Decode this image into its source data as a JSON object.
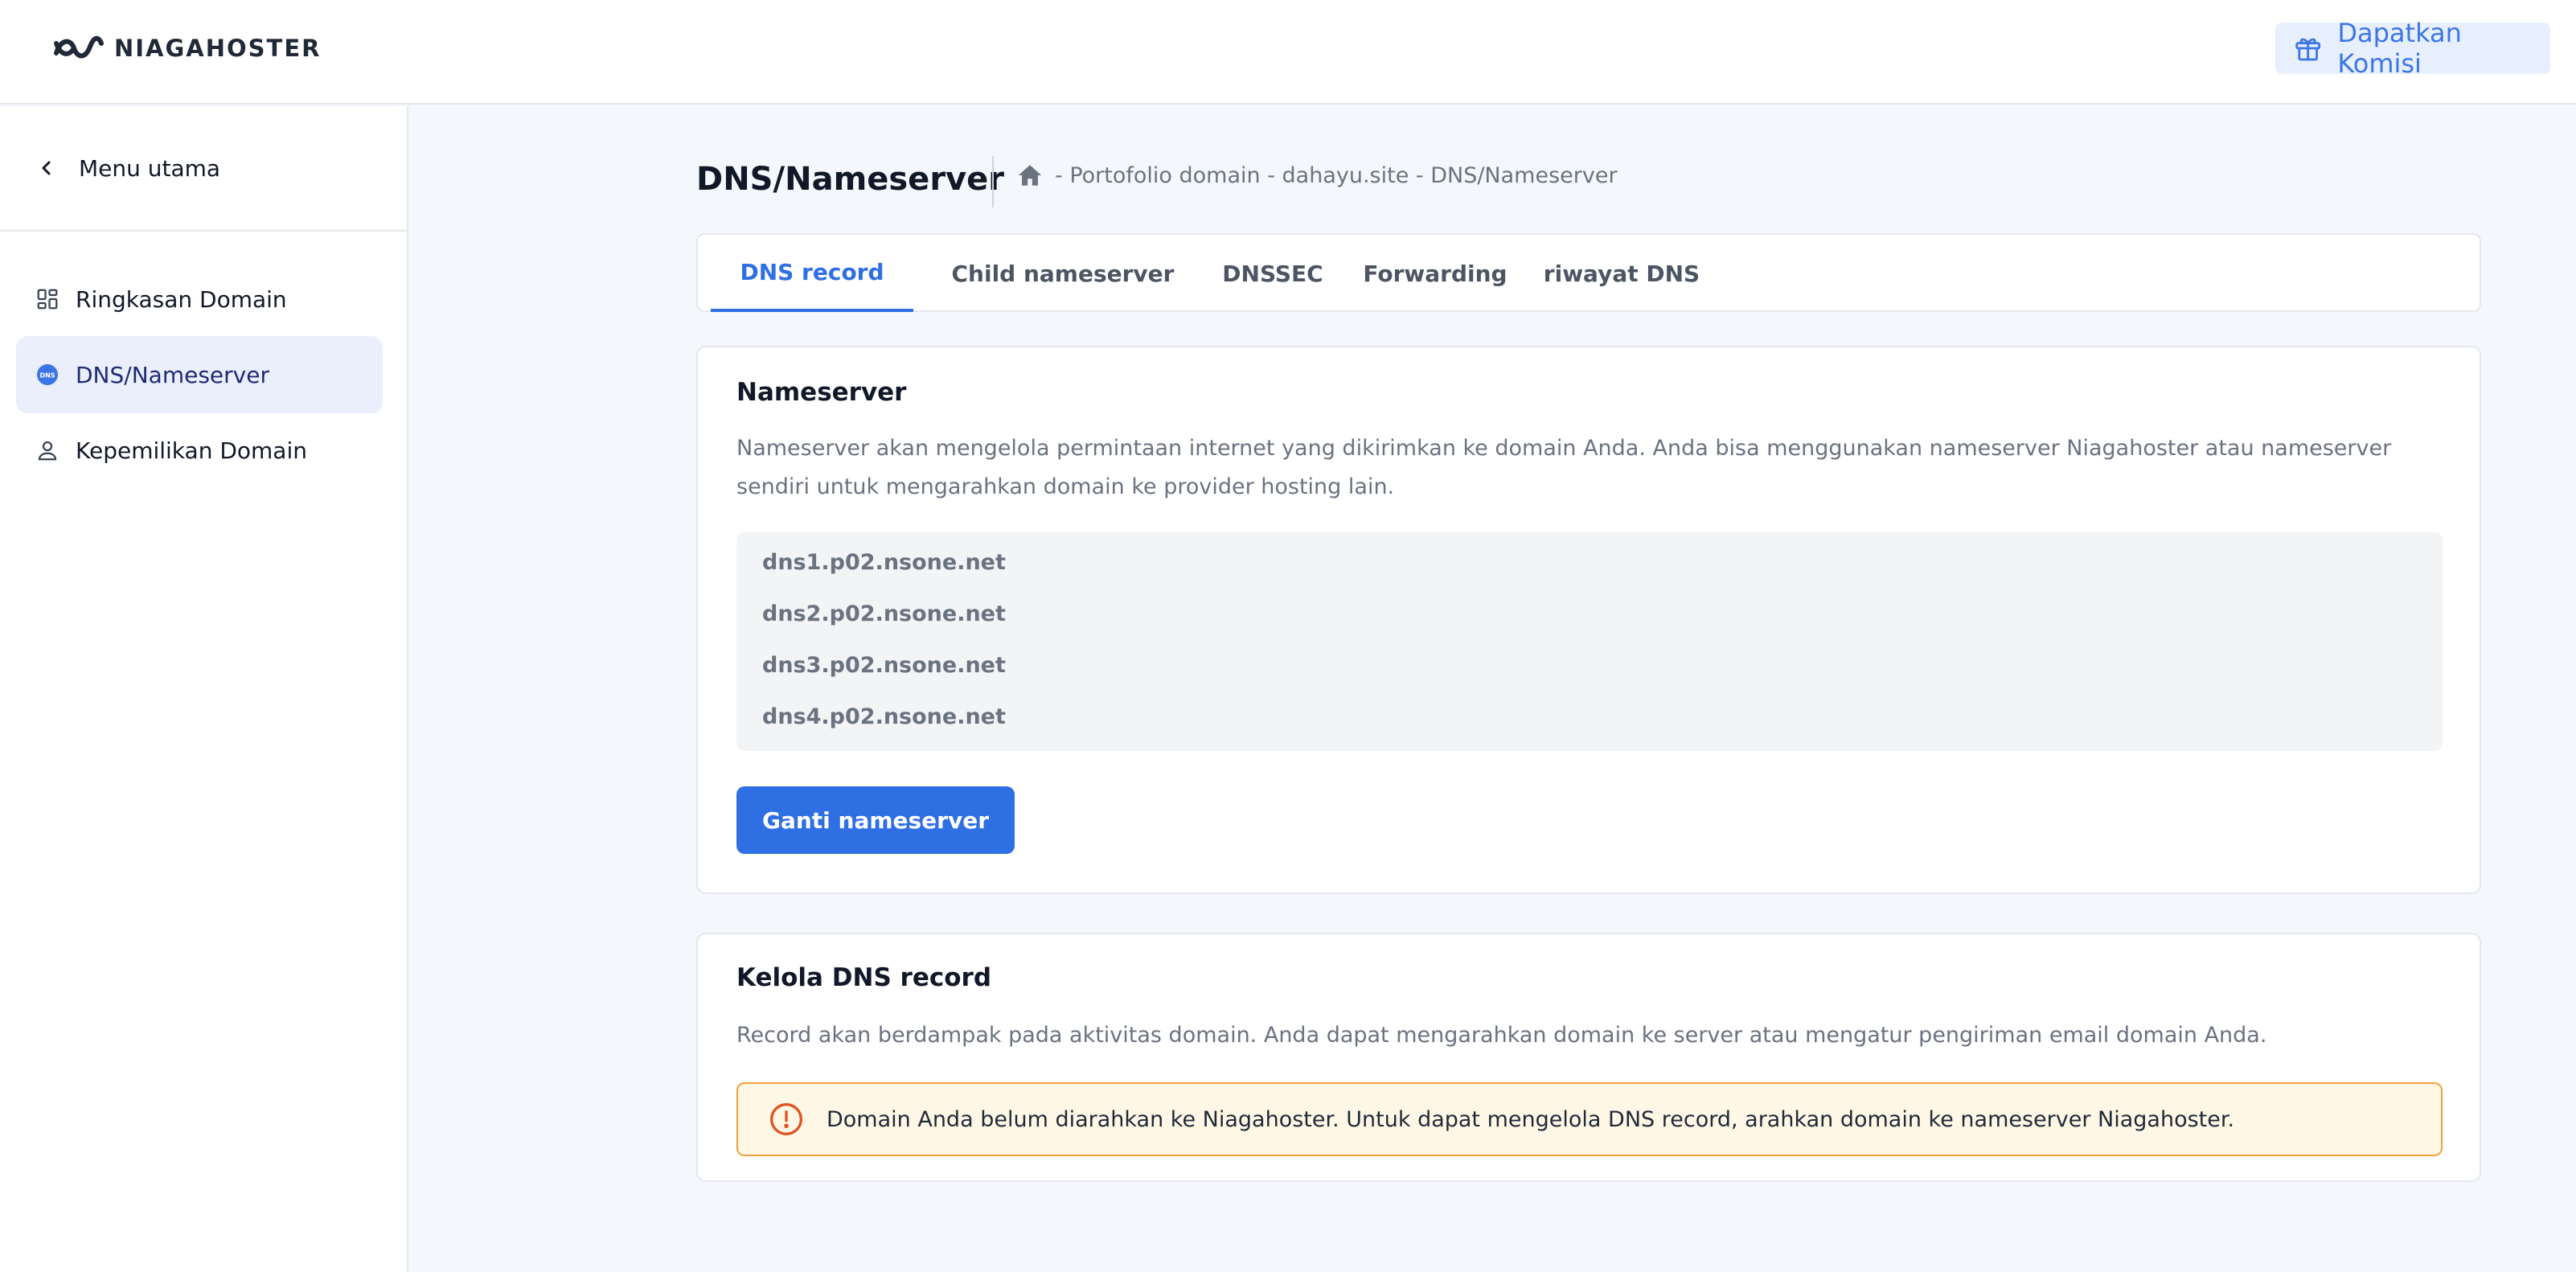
{
  "header": {
    "logo_text": "NIAGAHOSTER",
    "commission_label": "Dapatkan Komisi",
    "icons": {
      "logo": "niagahoster-wave-logo",
      "commission": "gift-icon"
    }
  },
  "sidebar": {
    "back_label": "Menu utama",
    "items": [
      {
        "label": "Ringkasan Domain",
        "icon": "dashboard-icon",
        "active": false
      },
      {
        "label": "DNS/Nameserver",
        "icon": "dns-icon",
        "active": true
      },
      {
        "label": "Kepemilikan Domain",
        "icon": "person-icon",
        "active": false
      }
    ]
  },
  "page": {
    "title": "DNS/Nameserver",
    "breadcrumb": "- Portofolio domain - dahayu.site - DNS/Nameserver"
  },
  "tabs": [
    {
      "label": "DNS record",
      "active": true
    },
    {
      "label": "Child nameserver",
      "active": false
    },
    {
      "label": "DNSSEC",
      "active": false
    },
    {
      "label": "Forwarding",
      "active": false
    },
    {
      "label": "riwayat DNS",
      "active": false
    }
  ],
  "nameserver_card": {
    "title": "Nameserver",
    "description": "Nameserver akan mengelola permintaan internet yang dikirimkan ke domain Anda. Anda bisa menggunakan nameserver Niagahoster atau nameserver sendiri untuk mengarahkan domain ke provider hosting lain.",
    "nameservers": [
      "dns1.p02.nsone.net",
      "dns2.p02.nsone.net",
      "dns3.p02.nsone.net",
      "dns4.p02.nsone.net"
    ],
    "button_label": "Ganti nameserver"
  },
  "dns_card": {
    "title": "Kelola DNS record",
    "description": "Record akan berdampak pada aktivitas domain. Anda dapat mengarahkan domain ke server atau mengatur pengiriman email domain Anda.",
    "alert_text": "Domain Anda belum diarahkan ke Niagahoster. Untuk dapat mengelola DNS record, arahkan domain ke nameserver Niagahoster."
  },
  "colors": {
    "accent": "#2f6fe4",
    "sidebar_active_bg": "#ebeefb",
    "warning_border": "#f0a23a",
    "warning_bg": "#fff7e6",
    "page_bg": "#f4f7fc"
  }
}
